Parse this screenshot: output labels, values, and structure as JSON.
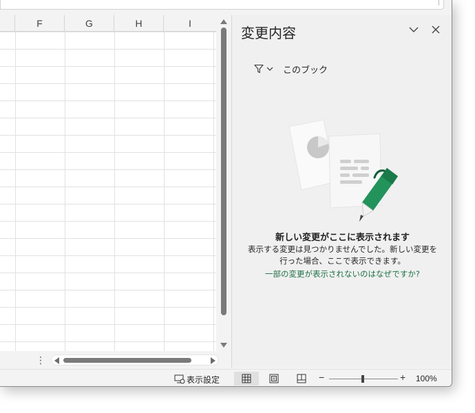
{
  "grid": {
    "columns": [
      "F",
      "G",
      "H",
      "I"
    ]
  },
  "changes_pane": {
    "title": "変更内容",
    "filter_label": "このブック",
    "empty_title": "新しい変更がここに表示されます",
    "empty_desc_line1": "表示する変更は見つかりませんでした。新しい変更を",
    "empty_desc_line2": "行った場合、ここで表示できます。",
    "help_link": "一部の変更が表示されないのはなぜですか?"
  },
  "statusbar": {
    "display_settings": "表示設定",
    "zoom_level": "100%",
    "zoom_minus": "−",
    "zoom_plus": "+",
    "zoom_fraction": 0.5
  },
  "colors": {
    "accent_green": "#1e7145",
    "pen_green": "#22935a"
  },
  "icons": [
    "filter-icon",
    "chevron-down-icon",
    "close-icon",
    "display-settings-icon",
    "normal-view-icon",
    "page-layout-icon",
    "page-break-preview-icon"
  ]
}
